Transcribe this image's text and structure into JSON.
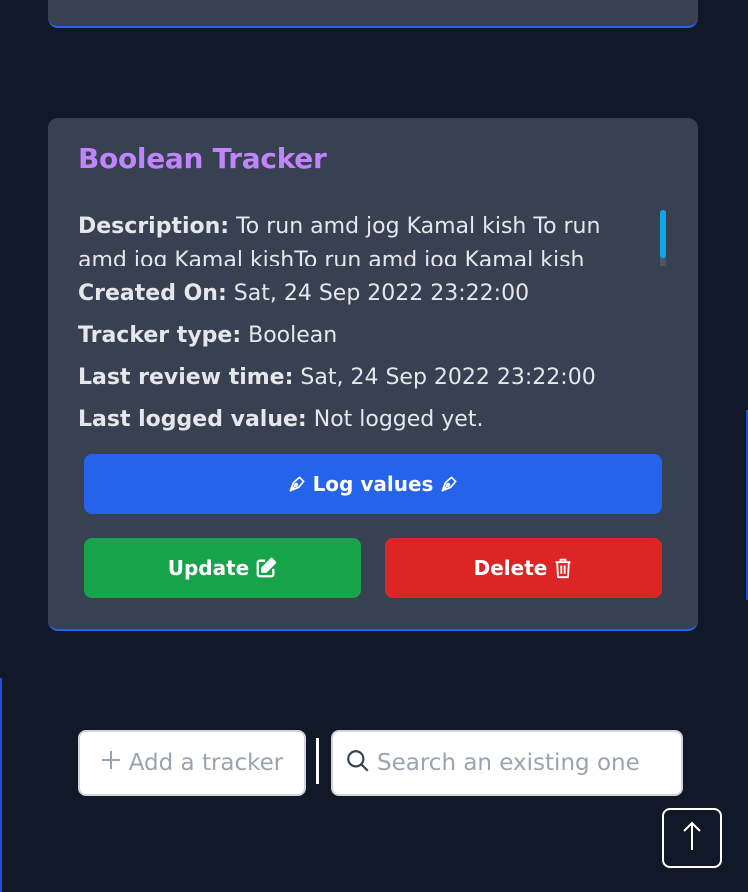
{
  "tracker": {
    "title": "Boolean Tracker",
    "description_label": "Description:",
    "description": "To run amd jog Kamal kish To run amd jog Kamal kishTo run amd jog Kamal kish",
    "created_label": "Created On:",
    "created_value": "Sat, 24 Sep 2022 23:22:00",
    "type_label": "Tracker type:",
    "type_value": "Boolean",
    "review_label": "Last review time:",
    "review_value": "Sat, 24 Sep 2022 23:22:00",
    "logged_label": "Last logged value:",
    "logged_value": "Not logged yet.",
    "log_button": "Log values",
    "update_button": "Update",
    "delete_button": "Delete"
  },
  "toolbar": {
    "add_label": "Add a tracker",
    "search_placeholder": "Search an existing one"
  },
  "icons": {
    "log": "pen-nib-icon",
    "update": "edit-icon",
    "delete": "trash-icon",
    "add": "plus-icon",
    "search": "search-icon",
    "scroll_top": "arrow-up-icon"
  },
  "colors": {
    "background": "#111827",
    "card": "#374151",
    "title": "#c084fc",
    "log_button": "#2563eb",
    "update_button": "#16a34a",
    "delete_button": "#dc2626"
  }
}
